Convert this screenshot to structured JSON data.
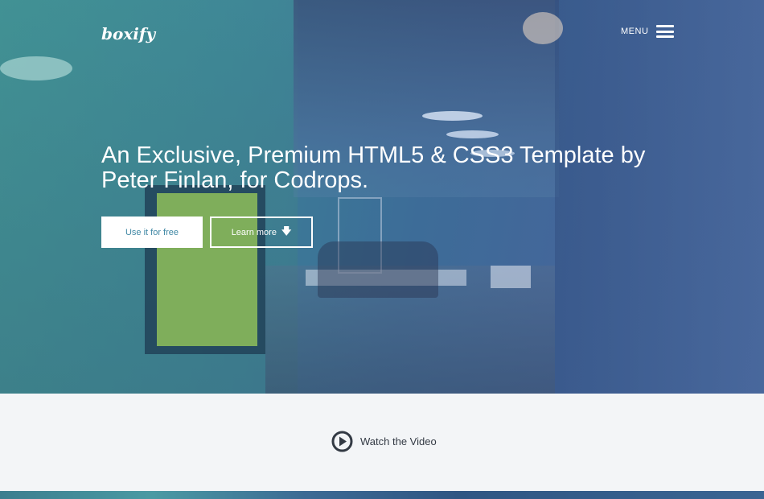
{
  "brand": {
    "logo": "boxify"
  },
  "nav": {
    "menu_label": "MENU"
  },
  "hero": {
    "headline": "An Exclusive, Premium HTML5 & CSS3 Template by Peter Finlan, for Codrops.",
    "buttons": {
      "primary": "Use it for free",
      "secondary": "Learn more"
    }
  },
  "video": {
    "label": "Watch the Video"
  },
  "colors": {
    "accent": "#3f87a4",
    "text_dark": "#333a44",
    "section_bg": "#f3f5f7"
  },
  "icons": {
    "menu": "hamburger-icon",
    "learn_more": "arrow-down-icon",
    "video": "play-icon"
  }
}
